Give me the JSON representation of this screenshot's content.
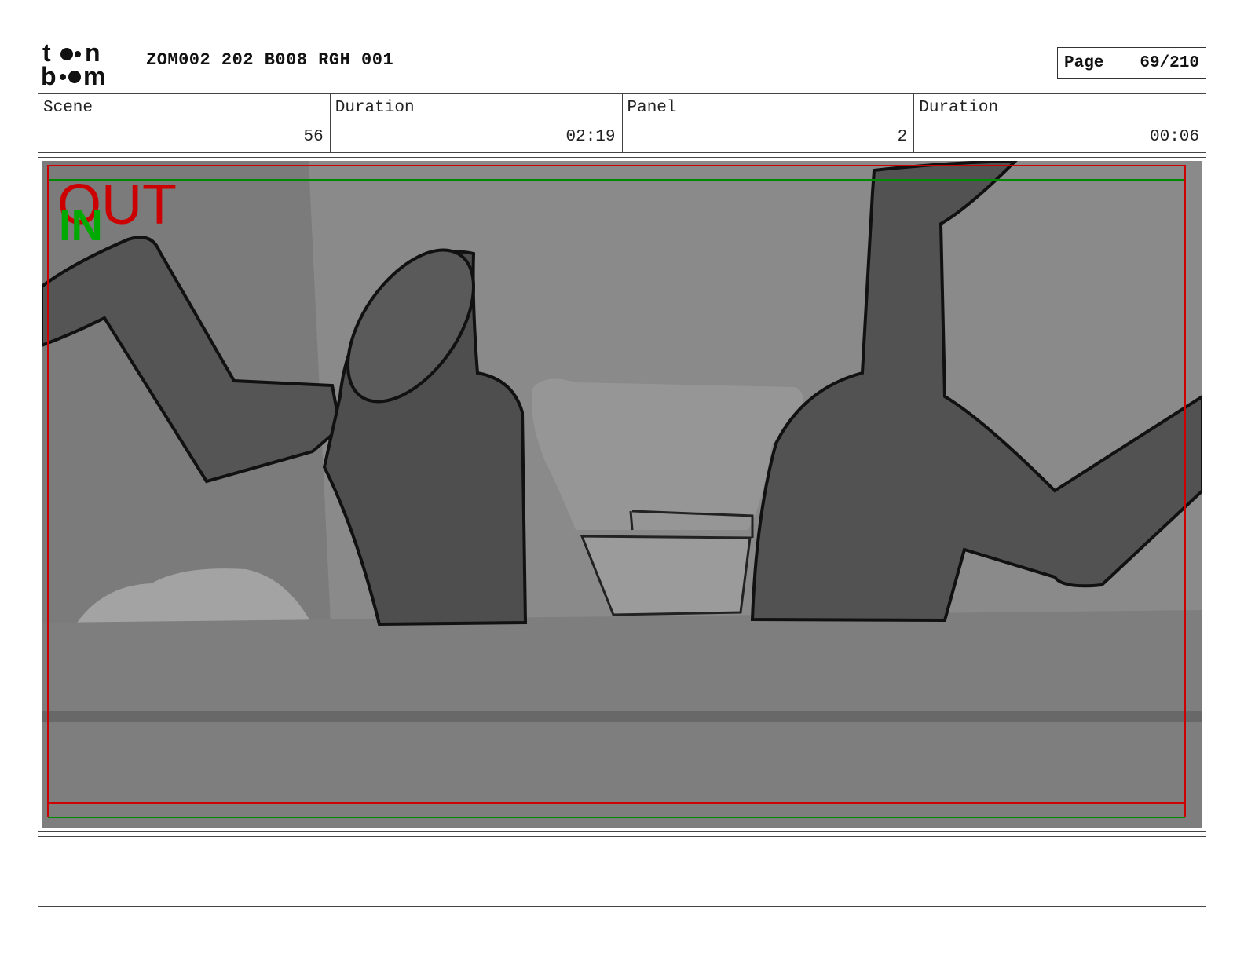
{
  "header": {
    "brand_icon": "toon-boom-logo",
    "project_title": "ZOM002 202 B008 RGH 001",
    "page_label": "Page",
    "page_value": "69/210"
  },
  "info": {
    "scene_label": "Scene",
    "scene_value": "56",
    "scene_duration_label": "Duration",
    "scene_duration_value": "02:19",
    "panel_label": "Panel",
    "panel_value": "2",
    "panel_duration_label": "Duration",
    "panel_duration_value": "00:06"
  },
  "panel": {
    "out_label": "OUT",
    "in_label": "IN",
    "out_color": "#cc0000",
    "in_color": "#00aa00"
  },
  "caption": {
    "text": ""
  }
}
